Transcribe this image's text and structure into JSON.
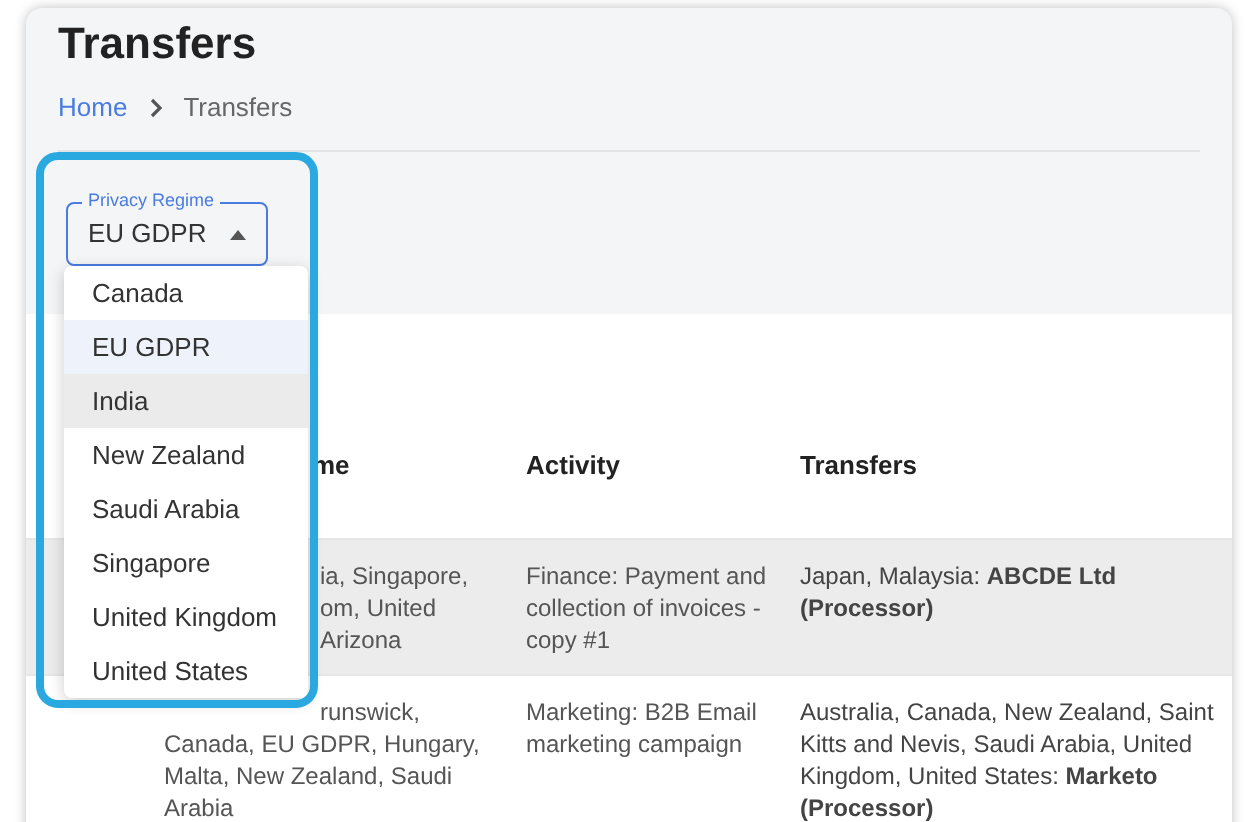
{
  "page": {
    "title": "Transfers"
  },
  "breadcrumb": [
    {
      "label": "Home",
      "kind": "link"
    },
    {
      "label": "Transfers",
      "kind": "current"
    }
  ],
  "filter": {
    "label": "Privacy Regime",
    "value": "EU GDPR",
    "expanded": true,
    "options": [
      {
        "label": "Canada",
        "selected": false,
        "hovered": false
      },
      {
        "label": "EU GDPR",
        "selected": true,
        "hovered": false
      },
      {
        "label": "India",
        "selected": false,
        "hovered": true
      },
      {
        "label": "New Zealand",
        "selected": false,
        "hovered": false
      },
      {
        "label": "Saudi Arabia",
        "selected": false,
        "hovered": false
      },
      {
        "label": "Singapore",
        "selected": false,
        "hovered": false
      },
      {
        "label": "United Kingdom",
        "selected": false,
        "hovered": false
      },
      {
        "label": "United States",
        "selected": false,
        "hovered": false
      }
    ]
  },
  "table": {
    "columns": [
      "me",
      "Activity",
      "Transfers"
    ],
    "rows": [
      {
        "highlighted": true,
        "column_1": {
          "partly_hidden_lines": [
            "ia, Singapore,",
            "om, United",
            "Arizona"
          ]
        },
        "activity": "Finance: Payment and collection of invoices - copy #1",
        "transfers": "Japan, Malaysia: **ABCDE Ltd (Processor)**"
      },
      {
        "highlighted": false,
        "column_1": {
          "partly_hidden_lines": [
            "runswick,"
          ],
          "lines": [
            "Canada, EU GDPR, Hungary,",
            "Malta, New Zealand, Saudi",
            "Arabia"
          ]
        },
        "activity": "Marketing: B2B Email marketing campaign",
        "transfers": "Australia, Canada, New Zealand, Saint Kitts and Nevis, Saudi Arabia, United Kingdom, United States: **Marketo (Processor)**"
      }
    ]
  }
}
